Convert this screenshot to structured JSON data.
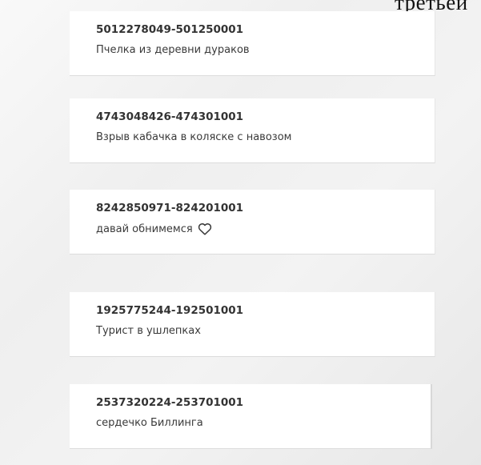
{
  "header": {
    "fragment": "третьей"
  },
  "cards": [
    {
      "title": "5012278049-501250001",
      "subtitle": "Пчелка из деревни дураков"
    },
    {
      "title": "4743048426-474301001",
      "subtitle": "Взрыв кабачка в коляске с навозом"
    },
    {
      "title": "8242850971-824201001",
      "subtitle": "давай обнимемся",
      "icon": "heart-outline-icon"
    },
    {
      "title": "1925775244-192501001",
      "subtitle": "Турист в ушлепках"
    },
    {
      "title": "2537320224-253701001",
      "subtitle": "сердечко Биллинга"
    }
  ]
}
